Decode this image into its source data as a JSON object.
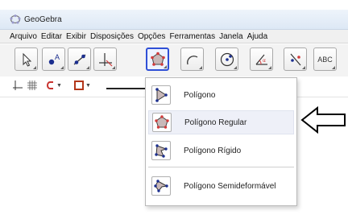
{
  "window": {
    "title": "GeoGebra",
    "title_icon": "geogebra-logo-icon"
  },
  "menu": [
    "Arquivo",
    "Editar",
    "Exibir",
    "Disposições",
    "Opções",
    "Ferramentas",
    "Janela",
    "Ajuda"
  ],
  "toolbar": {
    "tools": [
      {
        "name": "move-tool-icon"
      },
      {
        "name": "point-tool-icon"
      },
      {
        "name": "line-tool-icon"
      },
      {
        "name": "perpendicular-tool-icon"
      },
      {
        "name": "regular-polygon-tool-icon",
        "active": true
      },
      {
        "name": "arc-tool-icon"
      },
      {
        "name": "circle-tool-icon"
      },
      {
        "name": "angle-tool-icon"
      },
      {
        "name": "reflect-tool-icon"
      },
      {
        "name": "text-tool-icon",
        "label": "ABC"
      }
    ]
  },
  "dropdown": {
    "items": [
      {
        "label": "Polígono",
        "icon": "polygon-icon"
      },
      {
        "label": "Polígono Regular",
        "icon": "regular-polygon-icon",
        "highlighted": true
      },
      {
        "label": "Polígono Rígido",
        "icon": "rigid-polygon-icon"
      },
      {
        "label": "Polígono Semideformável",
        "icon": "vector-polygon-icon"
      }
    ]
  },
  "colors": {
    "accent": "#2f4fd6",
    "point": "#1c2f8f",
    "polygon_fill": "#c9b8b8",
    "highlight_point": "#d23a3a"
  }
}
